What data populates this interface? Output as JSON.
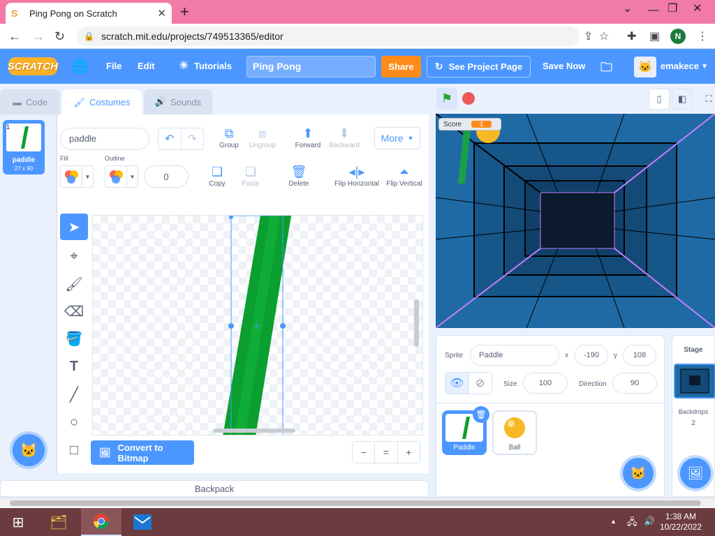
{
  "browser": {
    "tab_title": "Ping Pong on Scratch",
    "tab_favicon": "S",
    "url": "scratch.mit.edu/projects/749513365/editor",
    "profile_initial": "N"
  },
  "menubar": {
    "logo": "SCRATCH",
    "file": "File",
    "edit": "Edit",
    "tutorials": "Tutorials",
    "project_title": "Ping Pong",
    "share": "Share",
    "see_project_page": "See Project Page",
    "save_now": "Save Now",
    "username": "emakece"
  },
  "editor_tabs": {
    "code": "Code",
    "costumes": "Costumes",
    "sounds": "Sounds"
  },
  "costume_list": [
    {
      "num": "1",
      "name": "paddle",
      "size": "27 x 90"
    }
  ],
  "paint": {
    "costume_name": "paddle",
    "group": "Group",
    "ungroup": "Ungroup",
    "forward": "Forward",
    "backward": "Backward",
    "more": "More",
    "fill_label": "Fill",
    "outline_label": "Outline",
    "outline_width": "0",
    "copy": "Copy",
    "paste": "Paste",
    "delete": "Delete",
    "flip_horizontal": "Flip Horizontal",
    "flip_vertical": "Flip Vertical",
    "convert": "Convert to Bitmap",
    "zoom_out": "−",
    "zoom_reset": "=",
    "zoom_in": "+",
    "paddle_color": "#0a9f2e"
  },
  "backpack": "Backpack",
  "stage": {
    "score_label": "Score",
    "score_value": "1"
  },
  "sprite_info": {
    "sprite_label": "Sprite",
    "sprite_name": "Paddle",
    "x_label": "x",
    "x_value": "-190",
    "y_label": "y",
    "y_value": "108",
    "size_label": "Size",
    "size_value": "100",
    "direction_label": "Direction",
    "direction_value": "90"
  },
  "sprites": [
    {
      "name": "Paddle",
      "selected": true
    },
    {
      "name": "Ball",
      "selected": false
    }
  ],
  "stage_panel": {
    "title": "Stage",
    "backdrops_label": "Backdrops",
    "backdrops_count": "2"
  },
  "taskbar": {
    "time": "1:38 AM",
    "date": "10/22/2022"
  },
  "colors": {
    "scratch_blue": "#4c97ff",
    "share_orange": "#ff8c1a",
    "tab_pink": "#f27aa6"
  }
}
